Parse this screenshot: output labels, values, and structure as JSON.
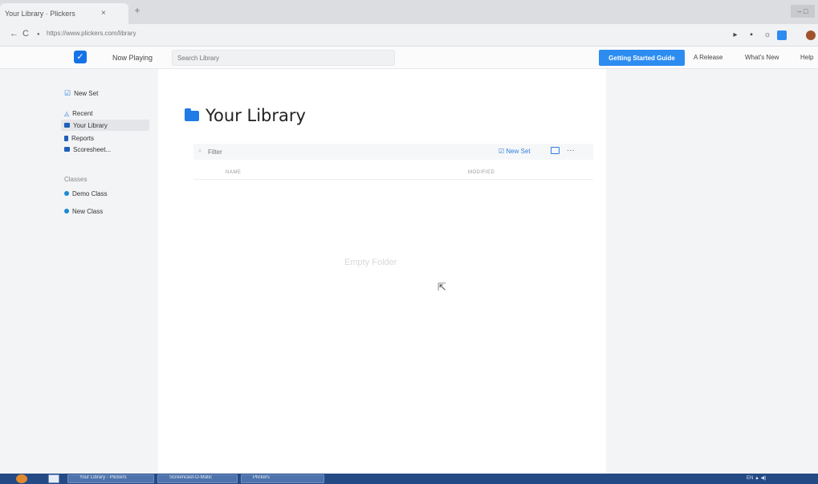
{
  "browser": {
    "tab_title": "Your Library · Plickers",
    "tab_close": "×",
    "tab_new": "+",
    "window_controls": "– □",
    "url": "https://www.plickers.com/library",
    "back": "←",
    "reload": "C",
    "lock": "●"
  },
  "topbar": {
    "logo_glyph": "✓",
    "now_playing": "Now Playing",
    "search_placeholder": "Search Library",
    "getting_started": "Getting Started Guide",
    "a_release": "A Release",
    "whats_new": "What's New",
    "help": "Help"
  },
  "sidebar": {
    "new_set": "New Set",
    "items": [
      {
        "label": "Recent"
      },
      {
        "label": "Your Library"
      },
      {
        "label": "Reports"
      },
      {
        "label": "Scoresheet..."
      }
    ],
    "classes_heading": "Classes",
    "classes": [
      {
        "label": "Demo Class",
        "color": "#1a8bd6"
      },
      {
        "label": "New Class",
        "color": "#1a8bd6"
      }
    ]
  },
  "main": {
    "title": "Your Library",
    "filter_placeholder": "Filter",
    "new_set_label": "New Set",
    "more_glyph": "···",
    "col_name": "NAME",
    "col_modified": "MODIFIED",
    "empty_state": "Empty Folder"
  },
  "taskbar": {
    "buttons": [
      "Your Library - Plickers",
      "Screencast-O-Matic",
      "Plickers"
    ],
    "tray_text": "EN  ▲  ◀)"
  },
  "colors": {
    "accent": "#2d8cf0",
    "brand_blue": "#1573e6"
  }
}
